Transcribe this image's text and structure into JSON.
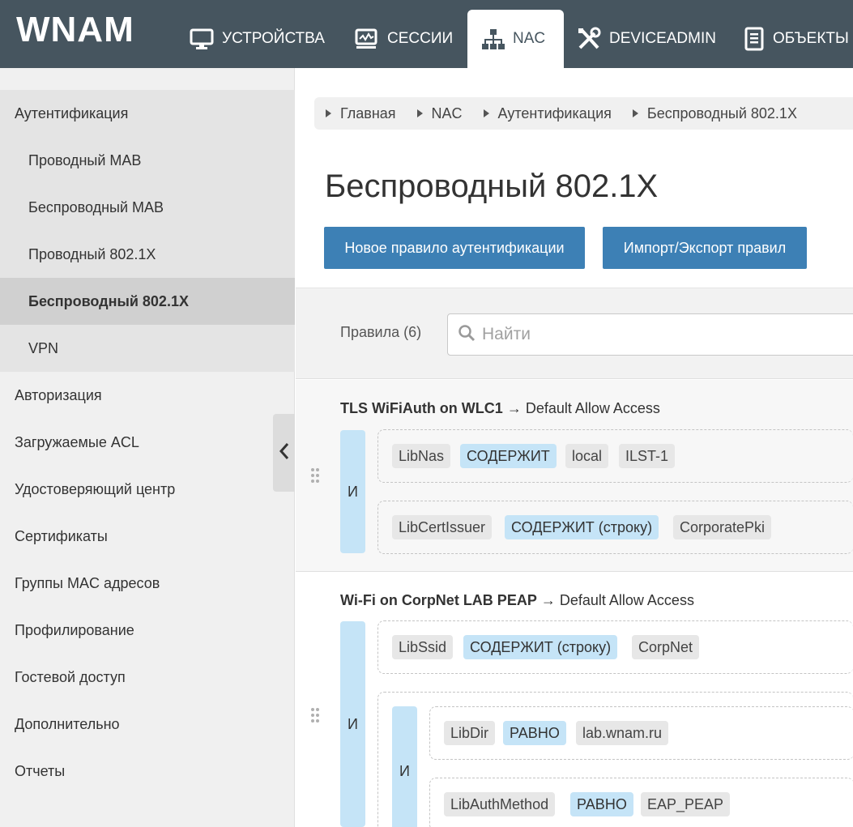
{
  "app": {
    "logo": "WNAM"
  },
  "nav": [
    {
      "label": "УСТРОЙСТВА",
      "icon": "monitor-icon"
    },
    {
      "label": "СЕССИИ",
      "icon": "chart-monitor-icon"
    },
    {
      "label": "NAC",
      "icon": "network-icon",
      "active": true
    },
    {
      "label": "DEVICEADMIN",
      "icon": "tools-icon"
    },
    {
      "label": "ОБЪЕКТЫ",
      "icon": "document-icon"
    }
  ],
  "sidebar": {
    "items": [
      {
        "label": "Аутентификация"
      },
      {
        "label": "Проводный MAB"
      },
      {
        "label": "Беспроводный MAB"
      },
      {
        "label": "Проводный 802.1X"
      },
      {
        "label": "Беспроводный 802.1X",
        "active": true
      },
      {
        "label": "VPN"
      },
      {
        "label": "Авторизация"
      },
      {
        "label": "Загружаемые ACL"
      },
      {
        "label": "Удостоверяющий центр"
      },
      {
        "label": "Сертификаты"
      },
      {
        "label": "Группы MAC адресов"
      },
      {
        "label": "Профилирование"
      },
      {
        "label": "Гостевой доступ"
      },
      {
        "label": "Дополнительно"
      },
      {
        "label": "Отчеты"
      }
    ]
  },
  "breadcrumb": [
    "Главная",
    "NAC",
    "Аутентификация",
    "Беспроводный 802.1X"
  ],
  "page": {
    "title": "Беспроводный 802.1X",
    "new_rule_button": "Новое правило аутентификации",
    "import_export_button": "Импорт/Экспорт правил"
  },
  "rules": {
    "count_label": "Правила (6)",
    "search_placeholder": "Найти",
    "items": [
      {
        "name": "TLS WiFiAuth on WLC1",
        "arrow": "→",
        "result": "Default Allow Access",
        "and_label": "И",
        "conditions": [
          {
            "attr": "LibNas",
            "op": "СОДЕРЖИТ",
            "vals": [
              "local",
              "ILST-1"
            ]
          },
          {
            "attr": "LibCertIssuer",
            "op": "СОДЕРЖИТ (строку)",
            "vals": [
              "CorporatePki"
            ]
          }
        ]
      },
      {
        "name": "Wi-Fi on CorpNet LAB PEAP",
        "arrow": "→",
        "result": "Default Allow Access",
        "and_label": "И",
        "nested_and_label": "И",
        "conditions": [
          {
            "attr": "LibSsid",
            "op": "СОДЕРЖИТ (строку)",
            "vals": [
              "CorpNet"
            ]
          },
          {
            "attr": "LibDir",
            "op": "РАВНО",
            "vals": [
              "lab.wnam.ru"
            ]
          },
          {
            "attr": "LibAuthMethod",
            "op": "РАВНО",
            "vals": [
              "EAP_PEAP"
            ]
          }
        ]
      }
    ]
  },
  "colors": {
    "topbar": "#46555f",
    "button": "#3d80b5",
    "operator_chip": "#c5e4f7"
  }
}
